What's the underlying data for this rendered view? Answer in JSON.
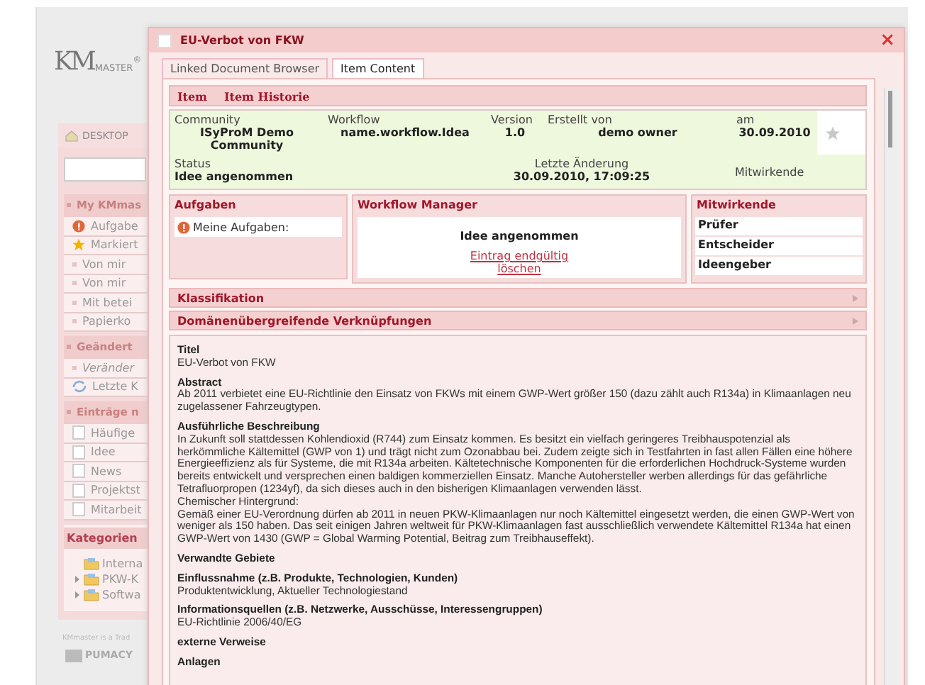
{
  "app": {
    "logo_monogram": "KM",
    "logo": "MASTER",
    "logo_mark": "®",
    "desktop_tab": "DESKTOP",
    "sidebar": [
      {
        "title": "My KMmas",
        "items": [
          {
            "label": "Aufgabe",
            "kind": "alert"
          },
          {
            "label": "Markiert",
            "kind": "star"
          },
          {
            "label": "Von mir",
            "kind": "bullet"
          },
          {
            "label": "Von mir",
            "kind": "bullet"
          },
          {
            "label": "Mit betei",
            "kind": "bullet"
          },
          {
            "label": "Papierko",
            "kind": "bullet"
          }
        ]
      },
      {
        "title": "Geändert",
        "items": [
          {
            "label": "Veränder",
            "kind": "bullet-italic"
          },
          {
            "label": "Letzte K",
            "kind": "recent"
          }
        ]
      },
      {
        "title": "Einträge n",
        "items": [
          {
            "label": "Häufige",
            "kind": "page"
          },
          {
            "label": "Idee",
            "kind": "page"
          },
          {
            "label": "News",
            "kind": "page"
          },
          {
            "label": "Projektst",
            "kind": "page"
          },
          {
            "label": "Mitarbeit",
            "kind": "page"
          }
        ]
      }
    ],
    "categories": {
      "title": "Kategorien",
      "items": [
        {
          "label": "Interna",
          "expandable": false
        },
        {
          "label": "PKW-K",
          "expandable": true
        },
        {
          "label": "Softwa",
          "expandable": true
        }
      ]
    },
    "footer": "KMmaster is a Trad",
    "footer_logo": "PUMACY"
  },
  "dialog": {
    "title": "EU-Verbot von FKW",
    "close": "×",
    "tabs": [
      {
        "label": "Linked Document Browser",
        "selected": false
      },
      {
        "label": "Item Content",
        "selected": true
      }
    ],
    "item_tabs": [
      "Item",
      "Item Historie"
    ],
    "info_rows": [
      [
        {
          "label": "Community",
          "value": "ISyProM Demo Community"
        },
        {
          "label": "Workflow",
          "value": "name.workflow.Idea"
        },
        {
          "label": "Version",
          "value": "1.0"
        },
        {
          "label": "Erstellt von",
          "value": "demo owner"
        },
        {
          "label": "am",
          "value": "30.09.2010"
        }
      ],
      [
        {
          "label": "Status",
          "value": "Idee angenommen"
        },
        {
          "label": "Letzte Änderung",
          "value": "30.09.2010, 17:09:25"
        },
        {
          "label": "Mitwirkende"
        }
      ]
    ],
    "tasks": {
      "title": "Aufgaben",
      "items": [
        "Meine Aufgaben:"
      ]
    },
    "workflow": {
      "title": "Workflow Manager",
      "state": "Idee angenommen",
      "link": "Eintrag endgültig löschen"
    },
    "contributors": {
      "title": "Mitwirkende",
      "roles": [
        "Prüfer",
        "Entscheider",
        "Ideengeber"
      ]
    },
    "sections": [
      {
        "title": "Klassifikation",
        "expanded": false
      },
      {
        "title": "Domänenübergreifende Verknüpfungen",
        "expanded": false
      }
    ],
    "details": [
      {
        "label": "Titel",
        "paragraphs": [
          "EU-Verbot von FKW"
        ]
      },
      {
        "label": "Abstract",
        "paragraphs": [
          "Ab 2011 verbietet eine EU-Richtlinie den Einsatz von FKWs mit einem GWP-Wert größer 150 (dazu zählt auch R134a) in Klimaanlagen neu zugelassener Fahrzeugtypen."
        ]
      },
      {
        "label": "Ausführliche Beschreibung",
        "paragraphs": [
          "In Zukunft soll stattdessen Kohlendioxid (R744) zum Einsatz kommen. Es besitzt ein vielfach geringeres Treibhauspotenzial als herkömmliche Kältemittel (GWP von 1) und trägt nicht zum Ozonabbau bei. Zudem zeigte sich in Testfahrten in fast allen Fällen eine höhere Energieeffizienz als für Systeme, die mit R134a arbeiten. Kältetechnische Komponenten für die erforderlichen Hochdruck-Systeme wurden bereits entwickelt und versprechen einen baldigen kommerziellen Einsatz. Manche Autohersteller werben allerdings für das gefährliche Tetrafluorpropen (1234yf), da sich dieses auch in den bisherigen Klimaanlagen verwenden lässt.",
          "Chemischer Hintergrund:",
          "Gemäß einer EU-Verordnung dürfen ab 2011 in neuen PKW-Klimaanlagen nur noch Kältemittel eingesetzt werden, die einen GWP-Wert von weniger als 150 haben. Das seit einigen Jahren weltweit für PKW-Klimaanlagen fast ausschließlich verwendete Kältemittel R134a hat einen GWP-Wert von 1430 (GWP = Global Warming Potential, Beitrag zum Treibhauseffekt)."
        ]
      },
      {
        "label": "Verwandte Gebiete"
      },
      {
        "label": "Einflussnahme (z.B. Produkte, Technologien, Kunden)",
        "paragraphs": [
          "Produktentwicklung, Aktueller Technologiestand"
        ]
      },
      {
        "label": "Informationsquellen (z.B. Netzwerke, Ausschüsse, Interessengruppen)",
        "paragraphs": [
          "EU-Richtlinie 2006/40/EG"
        ]
      },
      {
        "label": "externe Verweise"
      },
      {
        "label": "Anlagen"
      }
    ]
  }
}
